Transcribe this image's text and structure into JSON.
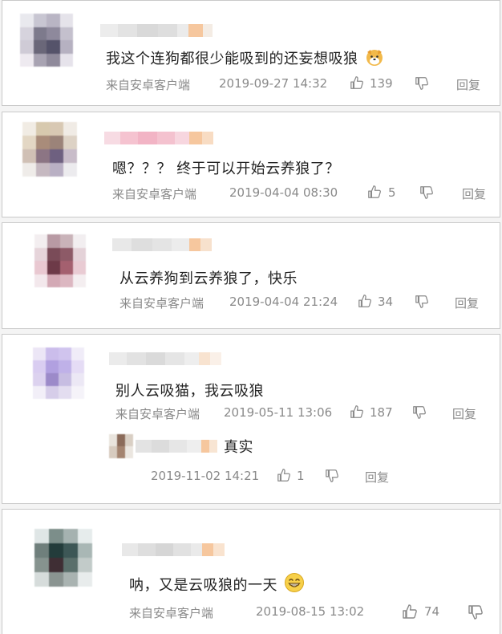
{
  "comments": [
    {
      "text": "我这个连狗都很少能吸到的还妄想吸狼",
      "emoji_icon": "dog-face-icon",
      "source": "来自安卓客户端",
      "time": "2019-09-27 14:32",
      "likes": "139",
      "reply_label": "回复"
    },
    {
      "text": "嗯？？？ 终于可以开始云养狼了？",
      "source": "来自安卓客户端",
      "time": "2019-04-04 08:30",
      "likes": "5",
      "reply_label": "回复"
    },
    {
      "text": "从云养狗到云养狼了，快乐",
      "source": "来自安卓客户端",
      "time": "2019-04-04 21:24",
      "likes": "34",
      "reply_label": "回复"
    },
    {
      "text": "别人云吸猫，我云吸狼",
      "source": "来自安卓客户端",
      "time": "2019-05-11 13:06",
      "likes": "187",
      "reply_label": "回复",
      "reply": {
        "text": "真实",
        "time": "2019-11-02 14:21",
        "likes": "1",
        "reply_label": "回复"
      }
    },
    {
      "text": "呐，又是云吸狼的一天",
      "emoji_icon": "grinning-face-icon",
      "source": "来自安卓客户端",
      "time": "2019-08-15 13:02",
      "likes": "74"
    }
  ],
  "colors": {
    "panel_border": "#c9c9c9",
    "meta_text": "#8a8a8a",
    "name_pink": "#f5b8c8",
    "name_orange": "#f6c79e"
  }
}
